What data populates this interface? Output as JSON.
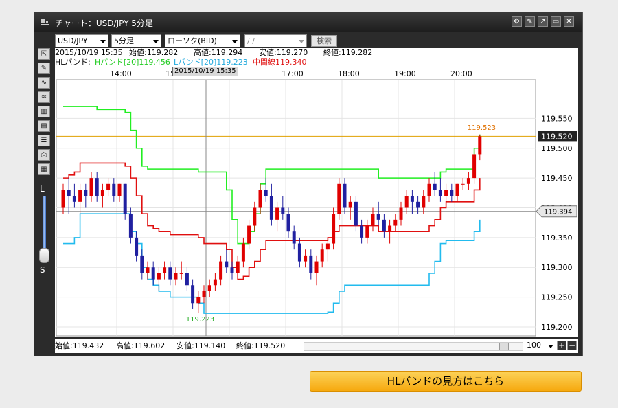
{
  "window": {
    "title": "チャート：USD/JPY 5分足",
    "buttons": [
      "⚙",
      "✎",
      "↗",
      "▭",
      "✕"
    ]
  },
  "toolbar": {
    "pair": "USD/JPY",
    "timeframe": "5分足",
    "price_type": "ローソク(BID)",
    "date": " /  / ",
    "search_label": "検索"
  },
  "info1": {
    "datetime": "2015/10/19 15:35",
    "open": "始値:119.282",
    "high": "高値:119.294",
    "low": "安値:119.270",
    "close": "終値:119.282"
  },
  "info2": {
    "label": "HLバンド:",
    "h": "Hバンド[20]119.456",
    "l": "Lバンド[20]119.223",
    "mid": "中間線119.340"
  },
  "time_axis": [
    "14:00",
    "15",
    "0",
    "17:00",
    "18:00",
    "19:00",
    "20:00"
  ],
  "crosshair_time": "2015/10/19 15:35",
  "zoom": {
    "top": "L",
    "bottom": "S"
  },
  "bottom": {
    "open": "始値:119.432",
    "high": "高値:119.602",
    "low": "安値:119.140",
    "close": "終値:119.520",
    "zoom": "100"
  },
  "guide_button": "HLバンドの見方はこちら",
  "colors": {
    "up": "#e00000",
    "down": "#2020a0",
    "hband": "#22ee22",
    "lband": "#22bbee",
    "mid": "#e01010",
    "price_line": "#e0a000"
  },
  "chart_data": {
    "type": "candlestick",
    "ylim": [
      119.185,
      119.615
    ],
    "y_ticks": [
      119.2,
      119.25,
      119.3,
      119.35,
      119.4,
      119.45,
      119.5,
      119.55
    ],
    "y_tick_labels": [
      "119.200",
      "119.250",
      "119.300",
      "119.350",
      "119.400",
      "119.450",
      "119.500",
      "119.550"
    ],
    "current_price": "119.520",
    "crosshair_price": "119.394",
    "max_label": "119.523",
    "min_label": "119.223",
    "max_value": 119.523,
    "min_value": 119.223,
    "last_price": 119.52,
    "crosshair_value": 119.394,
    "candles": [
      [
        119.4,
        119.44,
        119.39,
        119.43
      ],
      [
        119.43,
        119.45,
        119.39,
        119.42
      ],
      [
        119.42,
        119.44,
        119.4,
        119.41
      ],
      [
        119.41,
        119.44,
        119.39,
        119.43
      ],
      [
        119.43,
        119.44,
        119.4,
        119.42
      ],
      [
        119.42,
        119.46,
        119.41,
        119.45
      ],
      [
        119.45,
        119.46,
        119.41,
        119.42
      ],
      [
        119.42,
        119.44,
        119.4,
        119.43
      ],
      [
        119.43,
        119.45,
        119.42,
        119.44
      ],
      [
        119.44,
        119.45,
        119.41,
        119.42
      ],
      [
        119.42,
        119.44,
        119.41,
        119.44
      ],
      [
        119.44,
        119.44,
        119.38,
        119.39
      ],
      [
        119.39,
        119.4,
        119.34,
        119.35
      ],
      [
        119.35,
        119.36,
        119.31,
        119.32
      ],
      [
        119.32,
        119.33,
        119.28,
        119.29
      ],
      [
        119.29,
        119.31,
        119.28,
        119.3
      ],
      [
        119.3,
        119.31,
        119.27,
        119.28
      ],
      [
        119.28,
        119.3,
        119.26,
        119.29
      ],
      [
        119.29,
        119.31,
        119.28,
        119.3
      ],
      [
        119.3,
        119.31,
        119.27,
        119.28
      ],
      [
        119.28,
        119.3,
        119.27,
        119.29
      ],
      [
        119.29,
        119.31,
        119.28,
        119.29
      ],
      [
        119.29,
        119.3,
        119.26,
        119.27
      ],
      [
        119.27,
        119.28,
        119.23,
        119.24
      ],
      [
        119.24,
        119.26,
        119.223,
        119.25
      ],
      [
        119.25,
        119.27,
        119.24,
        119.26
      ],
      [
        119.26,
        119.28,
        119.25,
        119.27
      ],
      [
        119.27,
        119.29,
        119.26,
        119.28
      ],
      [
        119.28,
        119.32,
        119.27,
        119.31
      ],
      [
        119.31,
        119.33,
        119.29,
        119.3
      ],
      [
        119.3,
        119.31,
        119.28,
        119.29
      ],
      [
        119.29,
        119.32,
        119.28,
        119.31
      ],
      [
        119.31,
        119.35,
        119.3,
        119.34
      ],
      [
        119.34,
        119.38,
        119.33,
        119.37
      ],
      [
        119.37,
        119.41,
        119.36,
        119.4
      ],
      [
        119.4,
        119.44,
        119.39,
        119.43
      ],
      [
        119.43,
        119.45,
        119.41,
        119.42
      ],
      [
        119.42,
        119.44,
        119.37,
        119.38
      ],
      [
        119.38,
        119.41,
        119.36,
        119.4
      ],
      [
        119.4,
        119.42,
        119.38,
        119.39
      ],
      [
        119.39,
        119.4,
        119.35,
        119.36
      ],
      [
        119.36,
        119.37,
        119.33,
        119.34
      ],
      [
        119.34,
        119.35,
        119.3,
        119.31
      ],
      [
        119.31,
        119.33,
        119.3,
        119.32
      ],
      [
        119.32,
        119.33,
        119.28,
        119.29
      ],
      [
        119.29,
        119.32,
        119.27,
        119.31
      ],
      [
        119.31,
        119.34,
        119.3,
        119.33
      ],
      [
        119.33,
        119.35,
        119.31,
        119.34
      ],
      [
        119.34,
        119.4,
        119.33,
        119.39
      ],
      [
        119.39,
        119.45,
        119.38,
        119.44
      ],
      [
        119.44,
        119.45,
        119.39,
        119.4
      ],
      [
        119.4,
        119.42,
        119.38,
        119.41
      ],
      [
        119.41,
        119.42,
        119.36,
        119.37
      ],
      [
        119.37,
        119.38,
        119.34,
        119.35
      ],
      [
        119.35,
        119.38,
        119.34,
        119.37
      ],
      [
        119.37,
        119.4,
        119.36,
        119.39
      ],
      [
        119.39,
        119.41,
        119.37,
        119.38
      ],
      [
        119.38,
        119.39,
        119.35,
        119.36
      ],
      [
        119.36,
        119.38,
        119.34,
        119.37
      ],
      [
        119.37,
        119.39,
        119.36,
        119.38
      ],
      [
        119.38,
        119.41,
        119.37,
        119.4
      ],
      [
        119.4,
        119.43,
        119.39,
        119.42
      ],
      [
        119.42,
        119.43,
        119.39,
        119.41
      ],
      [
        119.41,
        119.42,
        119.39,
        119.4
      ],
      [
        119.4,
        119.43,
        119.39,
        119.42
      ],
      [
        119.42,
        119.45,
        119.41,
        119.44
      ],
      [
        119.44,
        119.46,
        119.42,
        119.43
      ],
      [
        119.43,
        119.45,
        119.41,
        119.42
      ],
      [
        119.42,
        119.44,
        119.4,
        119.43
      ],
      [
        119.43,
        119.44,
        119.41,
        119.42
      ],
      [
        119.42,
        119.44,
        119.41,
        119.44
      ],
      [
        119.44,
        119.45,
        119.43,
        119.44
      ],
      [
        119.44,
        119.46,
        119.43,
        119.45
      ],
      [
        119.45,
        119.5,
        119.44,
        119.49
      ],
      [
        119.49,
        119.523,
        119.48,
        119.52
      ]
    ],
    "h_band": [
      119.57,
      119.57,
      119.57,
      119.57,
      119.57,
      119.57,
      119.565,
      119.565,
      119.565,
      119.565,
      119.565,
      119.56,
      119.53,
      119.5,
      119.47,
      119.465,
      119.465,
      119.465,
      119.465,
      119.465,
      119.465,
      119.465,
      119.465,
      119.465,
      119.46,
      119.46,
      119.46,
      119.46,
      119.46,
      119.43,
      119.38,
      119.34,
      119.34,
      119.36,
      119.39,
      119.44,
      119.465,
      119.465,
      119.465,
      119.465,
      119.465,
      119.465,
      119.465,
      119.465,
      119.465,
      119.465,
      119.465,
      119.465,
      119.465,
      119.465,
      119.465,
      119.465,
      119.465,
      119.465,
      119.465,
      119.465,
      119.45,
      119.45,
      119.45,
      119.45,
      119.45,
      119.45,
      119.45,
      119.45,
      119.45,
      119.45,
      119.45,
      119.46,
      119.465,
      119.465,
      119.465,
      119.465,
      119.465,
      119.5,
      119.523
    ],
    "l_band": [
      119.34,
      119.34,
      119.35,
      119.39,
      119.39,
      119.39,
      119.39,
      119.39,
      119.39,
      119.39,
      119.39,
      119.39,
      119.36,
      119.34,
      119.3,
      119.28,
      119.27,
      119.26,
      119.26,
      119.25,
      119.25,
      119.25,
      119.25,
      119.25,
      119.24,
      119.223,
      119.223,
      119.223,
      119.223,
      119.223,
      119.223,
      119.223,
      119.223,
      119.223,
      119.223,
      119.223,
      119.223,
      119.223,
      119.223,
      119.223,
      119.223,
      119.223,
      119.223,
      119.223,
      119.223,
      119.223,
      119.223,
      119.225,
      119.24,
      119.26,
      119.27,
      119.27,
      119.27,
      119.27,
      119.27,
      119.27,
      119.27,
      119.27,
      119.27,
      119.27,
      119.27,
      119.27,
      119.27,
      119.27,
      119.27,
      119.29,
      119.31,
      119.34,
      119.345,
      119.345,
      119.345,
      119.345,
      119.345,
      119.36,
      119.38
    ],
    "mid_line": [
      119.45,
      119.455,
      119.46,
      119.475,
      119.475,
      119.475,
      119.475,
      119.475,
      119.475,
      119.475,
      119.475,
      119.47,
      119.45,
      119.42,
      119.39,
      119.37,
      119.365,
      119.36,
      119.36,
      119.355,
      119.355,
      119.355,
      119.355,
      119.355,
      119.35,
      119.34,
      119.34,
      119.34,
      119.34,
      119.33,
      119.3,
      119.28,
      119.285,
      119.3,
      119.31,
      119.33,
      119.345,
      119.345,
      119.345,
      119.345,
      119.345,
      119.345,
      119.345,
      119.345,
      119.345,
      119.345,
      119.345,
      119.35,
      119.36,
      119.37,
      119.37,
      119.37,
      119.37,
      119.37,
      119.37,
      119.37,
      119.36,
      119.36,
      119.36,
      119.36,
      119.36,
      119.36,
      119.36,
      119.36,
      119.36,
      119.37,
      119.38,
      119.4,
      119.41,
      119.41,
      119.41,
      119.41,
      119.41,
      119.43,
      119.45
    ]
  }
}
